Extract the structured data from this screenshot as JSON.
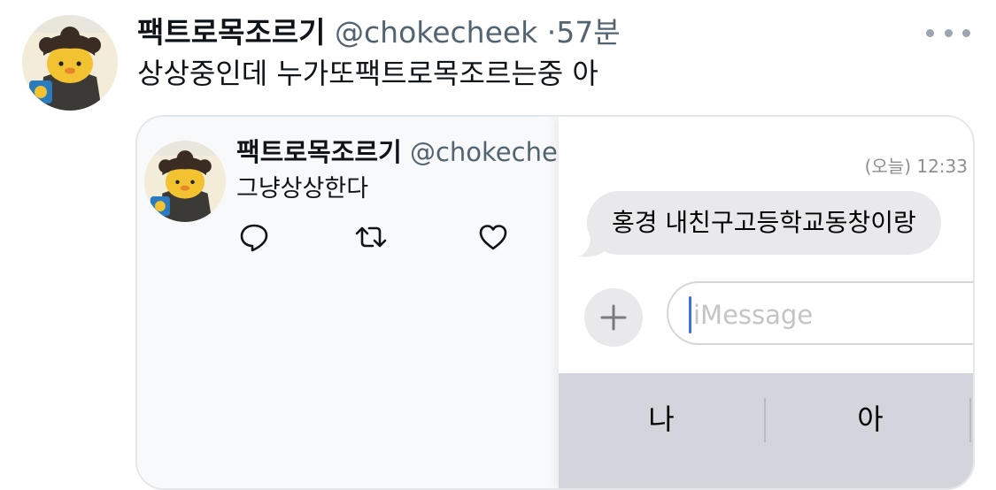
{
  "tweet": {
    "display_name": "팩트로목조르기",
    "handle": "@chokecheek",
    "separator": "·",
    "time": "57분",
    "text": "상상중인데 누가또팩트로목조르는중 아"
  },
  "quoted_tweet": {
    "display_name": "팩트로목조르기",
    "handle": "@chokechee",
    "text": "그냥상상한다"
  },
  "imessage": {
    "timestamp": "(오늘) 12:33",
    "bubble_text": "홍경 내친구고등학교동창이랑",
    "input_placeholder": "iMessage",
    "keyboard_keys": [
      "나",
      "아"
    ]
  },
  "colors": {
    "text_primary": "#0f1419",
    "text_secondary": "#536471",
    "bubble_gray": "#e9e9eb",
    "keyboard_gray": "#d2d5db",
    "caret_blue": "#3a6fe6"
  },
  "icons": {
    "more": "more-dots-icon",
    "reply": "reply-icon",
    "retweet": "retweet-icon",
    "like": "heart-icon",
    "plus": "plus-icon"
  }
}
